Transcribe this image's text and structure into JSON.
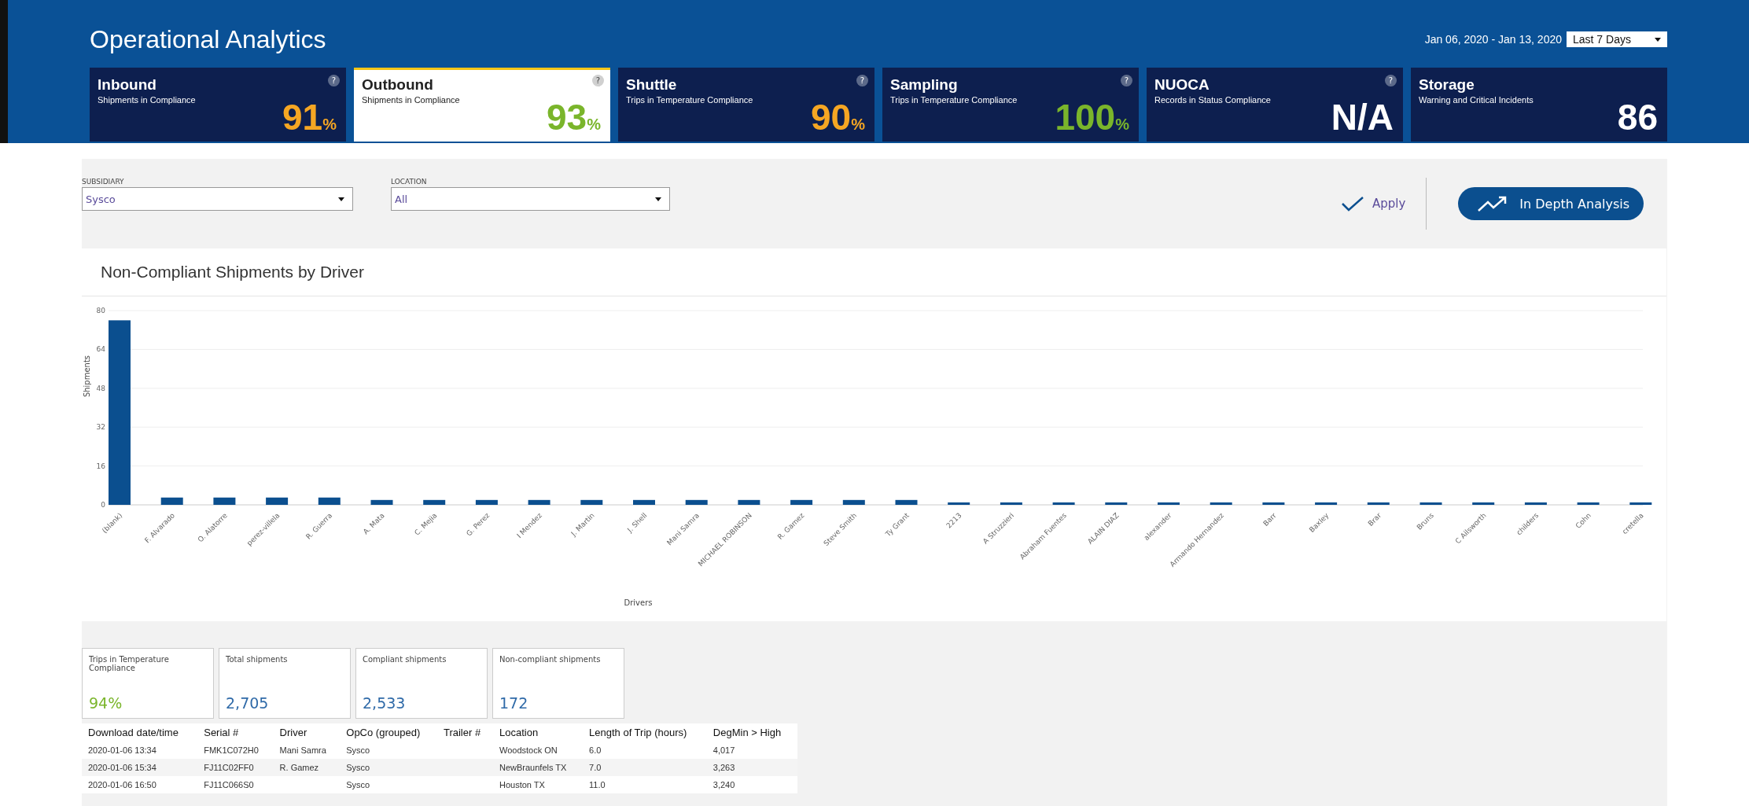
{
  "header": {
    "title": "Operational Analytics",
    "date_range": "Jan 06, 2020 - Jan 13, 2020",
    "period": {
      "value": "Last 7 Days"
    }
  },
  "kpi_cards": [
    {
      "title": "Inbound",
      "subtitle": "Shipments in Compliance",
      "value": "91",
      "unit": "%",
      "color": "#f5a623",
      "help": "?",
      "selected": false
    },
    {
      "title": "Outbound",
      "subtitle": "Shipments in Compliance",
      "value": "93",
      "unit": "%",
      "color": "#7ab52b",
      "help": "?",
      "selected": true
    },
    {
      "title": "Shuttle",
      "subtitle": "Trips in Temperature Compliance",
      "value": "90",
      "unit": "%",
      "color": "#f5a623",
      "help": "?",
      "selected": false
    },
    {
      "title": "Sampling",
      "subtitle": "Trips in Temperature Compliance",
      "value": "100",
      "unit": "%",
      "color": "#7ab52b",
      "help": "?",
      "selected": false
    },
    {
      "title": "NUOCA",
      "subtitle": "Records in Status Compliance",
      "value": "N/A",
      "color": "#ffffff",
      "help": "?",
      "selected": false
    },
    {
      "title": "Storage",
      "subtitle": "Warning and Critical Incidents",
      "value": "86",
      "color": "#ffffff",
      "selected": false
    }
  ],
  "filters": [
    {
      "label": "SUBSIDIARY",
      "value": "Sysco"
    },
    {
      "label": "LOCATION",
      "value": "All"
    }
  ],
  "actions": {
    "apply": "Apply",
    "analysis": "In Depth Analysis"
  },
  "chart_card": {
    "title": "Non-Compliant Shipments by Driver",
    "chart_data": {
      "type": "bar",
      "xlabel": "Drivers",
      "ylabel": "Shipments",
      "ylim": [
        0,
        80
      ],
      "yticks": [
        0,
        16,
        32,
        48,
        64,
        80
      ],
      "grid": true,
      "categories": [
        "(blank)",
        "F. Alvarado",
        "O. Alatorre",
        "perez-villela",
        "R. Guerra",
        "A. Mata",
        "C. Mejia",
        "G. Perez",
        "I Mendez",
        "J. Martin",
        "J. Shell",
        "Mani Samra",
        "MICHAEL ROBINSON",
        "R. Gamez",
        "Steve Smith",
        "Ty Grant",
        "2213",
        "A Struzzieri",
        "Abraham Fuentes",
        "ALAIN DIAZ",
        "alexander",
        "Armando Hernandez",
        "Barr",
        "Baxley",
        "Brar",
        "Bruns",
        "C Ailsworth",
        "childers",
        "Cohn",
        "cretella"
      ],
      "values": [
        76,
        3,
        3,
        3,
        3,
        2,
        2,
        2,
        2,
        2,
        2,
        2,
        2,
        2,
        2,
        2,
        1,
        1,
        1,
        1,
        1,
        1,
        1,
        1,
        1,
        1,
        1,
        1,
        1,
        1
      ]
    }
  },
  "stats": [
    {
      "label": "Trips in Temperature Compliance",
      "value": "94%",
      "color": "#7ab52b"
    },
    {
      "label": "Total shipments",
      "value": "2,705",
      "color": "#2f6aa8"
    },
    {
      "label": "Compliant shipments",
      "value": "2,533",
      "color": "#2f6aa8"
    },
    {
      "label": "Non-compliant shipments",
      "value": "172",
      "color": "#2f6aa8"
    }
  ],
  "table": {
    "columns": [
      "Download date/time",
      "Serial #",
      "Driver",
      "OpCo (grouped)",
      "Trailer #",
      "Location",
      "Length of Trip (hours)",
      "DegMin > High"
    ],
    "rows": [
      [
        "2020-01-06 13:34",
        "FMK1C072H0",
        "Mani Samra",
        "Sysco",
        "",
        "Woodstock ON",
        "6.0",
        "4,017"
      ],
      [
        "2020-01-06 15:34",
        "FJ11C02FF0",
        "R. Gamez",
        "Sysco",
        "",
        "NewBraunfels TX",
        "7.0",
        "3,263"
      ],
      [
        "2020-01-06 16:50",
        "FJ11C066S0",
        "",
        "Sysco",
        "",
        "Houston TX",
        "11.0",
        "3,240"
      ]
    ]
  }
}
